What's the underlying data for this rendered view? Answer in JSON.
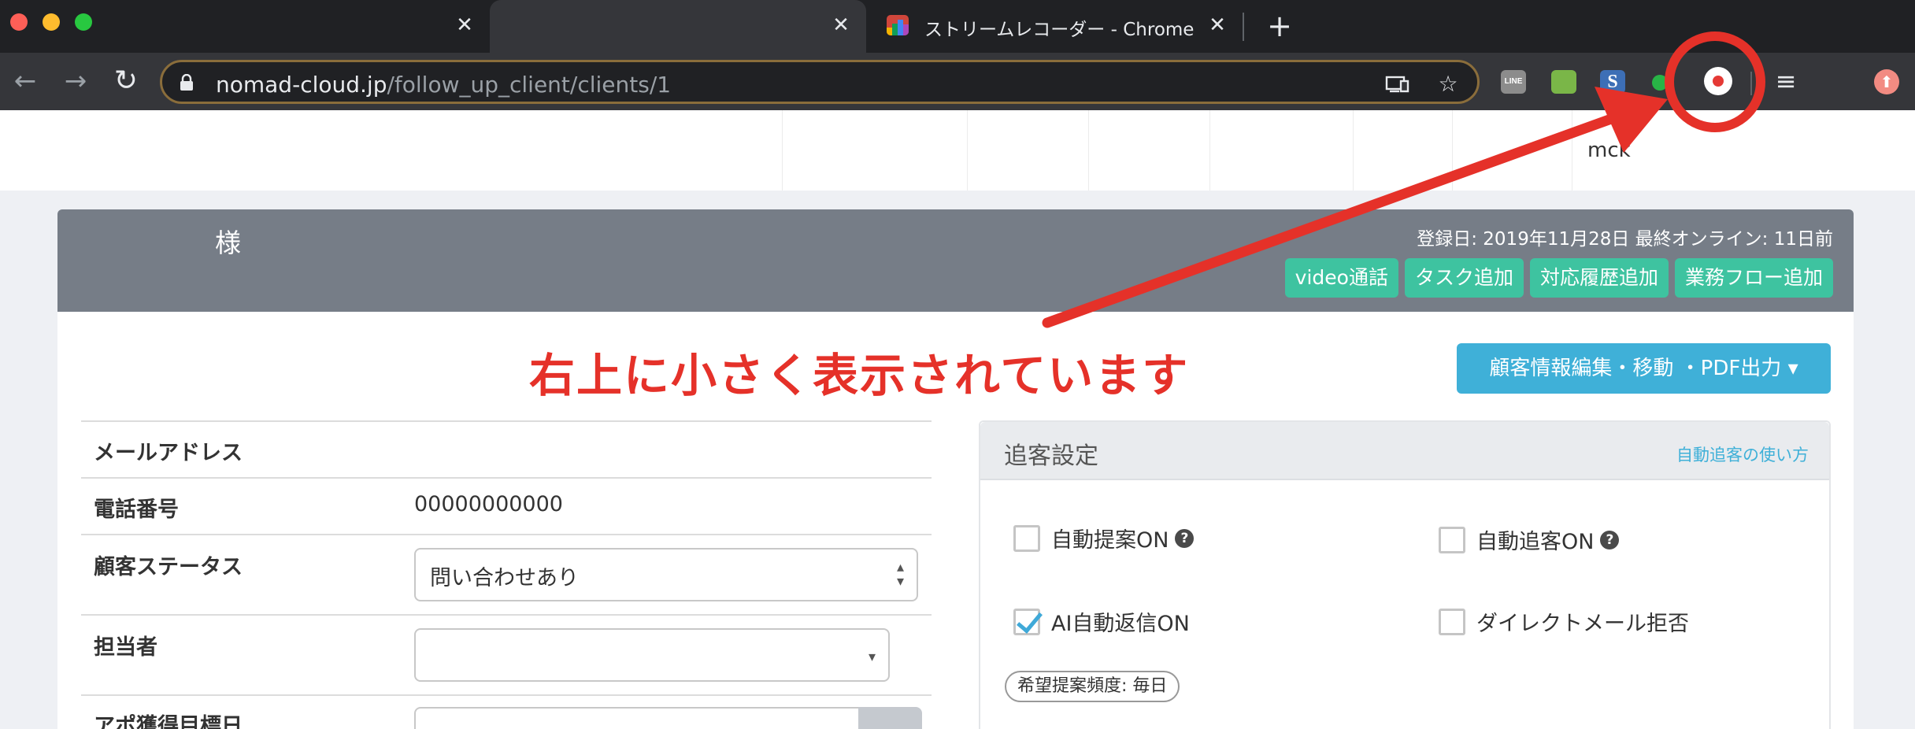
{
  "browser": {
    "tabs": [
      {
        "title": "",
        "close": "✕"
      },
      {
        "title": "",
        "close": "✕"
      },
      {
        "title": "ストリームレコーダー - Chrome ウ",
        "close": "✕"
      }
    ],
    "new_tab": "+",
    "url_host": "nomad-cloud.jp",
    "url_path": "/follow_up_client/clients/1",
    "extensions": [
      "line-icon",
      "green-ext-icon",
      "s-ext-icon",
      "green-dot-icon",
      "record-icon",
      "media-queue-icon"
    ],
    "ext_line_label": "LINE"
  },
  "header": {
    "user": "mck"
  },
  "client": {
    "name_suffix": "様",
    "registration": "登録日: 2019年11月28日 最終オンライン: 11日前",
    "actions": [
      "video通話",
      "タスク追加",
      "対応履歴追加",
      "業務フロー追加"
    ],
    "edit_button": "顧客情報編集・移動 ・PDF出力",
    "edit_caret": "▾"
  },
  "annotation": {
    "text": "右上に小さく表示されています",
    "color": "#e53129"
  },
  "info": {
    "rows": [
      {
        "label": "メールアドレス",
        "value": ""
      },
      {
        "label": "電話番号",
        "value": "00000000000"
      },
      {
        "label": "顧客ステータス",
        "value": "問い合わせあり"
      },
      {
        "label": "担当者",
        "value": ""
      },
      {
        "label": "アポ獲得目標日",
        "value": ""
      }
    ]
  },
  "followup": {
    "title": "追客設定",
    "help_link": "自動追客の使い方",
    "options": [
      {
        "label": "自動提案ON",
        "checked": false,
        "help": "?"
      },
      {
        "label": "自動追客ON",
        "checked": false,
        "help": "?"
      },
      {
        "label": "AI自動返信ON",
        "checked": true
      },
      {
        "label": "ダイレクトメール拒否",
        "checked": false
      }
    ],
    "frequency": "希望提案頻度: 毎日"
  },
  "colors": {
    "accent_teal": "#3ec3a0",
    "accent_blue": "#3fb0d8",
    "header_gray": "#767d87",
    "annotation_red": "#e53129"
  }
}
